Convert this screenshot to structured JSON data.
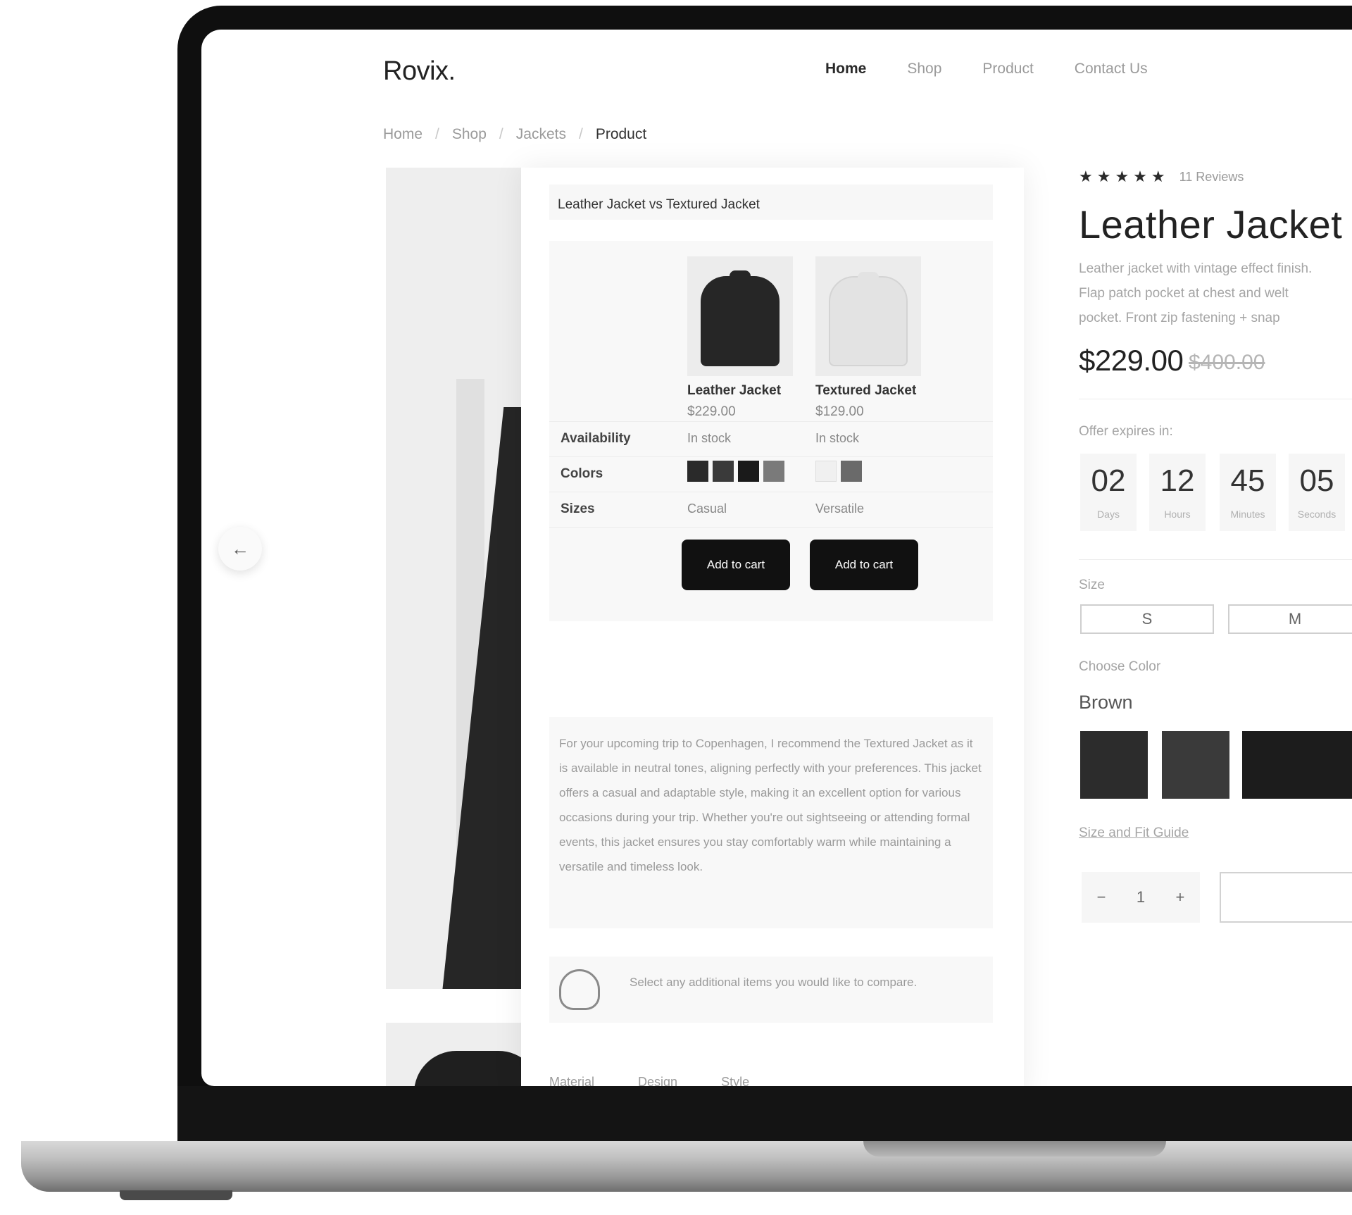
{
  "brand": {
    "logo": "Rovix."
  },
  "nav": {
    "items": [
      "Home",
      "Shop",
      "Product",
      "Contact Us"
    ]
  },
  "breadcrumb": {
    "items": [
      "Home",
      "Shop",
      "Jackets",
      "Product"
    ]
  },
  "compare": {
    "title": "Leather Jacket vs Textured Jacket",
    "products": [
      {
        "name": "Leather Jacket",
        "price": "$229.00",
        "availability": "In stock",
        "size": "Casual",
        "button": "Add to cart",
        "swatches": [
          "#2a2a2a",
          "#3a3a3a",
          "#1a1a1a",
          "#7a7a7a"
        ]
      },
      {
        "name": "Textured Jacket",
        "price": "$129.00",
        "availability": "In stock",
        "size": "Versatile",
        "button": "Add to cart",
        "swatches": [
          "#f0f0f0",
          "#6a6a6a"
        ]
      }
    ],
    "rows": {
      "availability": "Availability",
      "colors": "Colors",
      "sizes": "Sizes"
    },
    "recommendation": "For your upcoming trip to Copenhagen, I recommend the Textured Jacket as it is available in neutral tones, aligning perfectly with your preferences. This jacket offers a casual and adaptable style, making it an excellent option for various occasions during your trip. Whether you're out sightseeing or attending formal events, this jacket ensures you stay comfortably warm while maintaining a versatile and timeless look.",
    "hint": "Select any additional items you would like to compare.",
    "tabs": [
      "Material",
      "Design",
      "Style"
    ]
  },
  "product": {
    "stars": "★★★★★",
    "reviews": "11 Reviews",
    "title": "Leather Jacket",
    "description": [
      "Leather jacket with vintage effect finish.",
      "Flap patch pocket at chest and welt",
      "pocket. Front zip fastening + snap"
    ],
    "price": "$229.00",
    "old_price": "$400.00",
    "offer_label": "Offer expires in:",
    "countdown": [
      {
        "value": "02",
        "label": "Days"
      },
      {
        "value": "12",
        "label": "Hours"
      },
      {
        "value": "45",
        "label": "Minutes"
      },
      {
        "value": "05",
        "label": "Seconds"
      }
    ],
    "size_label": "Size",
    "sizes": [
      "S",
      "M"
    ],
    "choose_color": "Choose Color",
    "color_name": "Brown",
    "colors": [
      "#2c2c2c",
      "#3a3a3a",
      "#1c1c1c"
    ],
    "size_guide": "Size and Fit Guide",
    "qty": {
      "minus": "−",
      "value": "1",
      "plus": "+"
    }
  }
}
